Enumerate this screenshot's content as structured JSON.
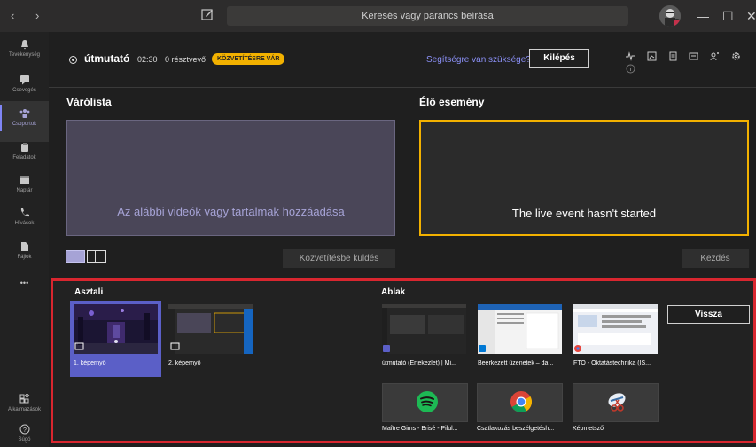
{
  "titlebar": {
    "nav_arrows": "‹   ›",
    "search_placeholder": "Keresés vagy parancs beírása",
    "minimize": "—",
    "maximize": "☐",
    "close": "✕"
  },
  "rail": [
    {
      "label": "Tevékenység",
      "icon": "bell-icon"
    },
    {
      "label": "Csevegés",
      "icon": "chat-icon"
    },
    {
      "label": "Csoportok",
      "icon": "teams-icon"
    },
    {
      "label": "Feladatok",
      "icon": "assignments-icon"
    },
    {
      "label": "Naptár",
      "icon": "calendar-icon"
    },
    {
      "label": "Hívások",
      "icon": "phone-icon"
    },
    {
      "label": "Fájlok",
      "icon": "files-icon"
    },
    {
      "label": "•••",
      "icon": "more-icon"
    },
    {
      "label": "Alkalmazások",
      "icon": "apps-icon"
    },
    {
      "label": "Súgó",
      "icon": "help-icon"
    }
  ],
  "event": {
    "title": "útmutató",
    "time": "02:30",
    "participants": "0 résztvevő",
    "status_badge": "KÖZVETÍTÉSRE VÁR",
    "help_link": "Segítségre van szüksége?",
    "leave_button": "Kilépés"
  },
  "queue": {
    "label": "Várólista",
    "placeholder": "Az alábbi videók vagy tartalmak hozzáadása",
    "send_button": "Közvetítésbe küldés"
  },
  "live": {
    "label": "Élő esemény",
    "status": "The live event hasn't started",
    "start_button": "Kezdés"
  },
  "share": {
    "desktop_label": "Asztali",
    "windows_label": "Ablak",
    "back_button": "Vissza",
    "screens": [
      {
        "label": "1. képernyő",
        "selected": true
      },
      {
        "label": "2. képernyő",
        "selected": false
      }
    ],
    "windows": [
      {
        "label": "útmutató (Értekezlet) | Mi..."
      },
      {
        "label": "Beérkezett üzenetek – da..."
      },
      {
        "label": "FTO - Oktatástechnika (IS..."
      }
    ],
    "apps": [
      {
        "label": "Maître Gims - Brisé - Pilul...",
        "icon": "spotify-icon"
      },
      {
        "label": "Csatlakozás beszélgetésh...",
        "icon": "chrome-icon"
      },
      {
        "label": "Képmetsző",
        "icon": "snipping-tool-icon"
      }
    ]
  },
  "colors": {
    "accent": "#5b5fc7",
    "badge": "#f2b100",
    "highlight_border": "#d9262f"
  }
}
